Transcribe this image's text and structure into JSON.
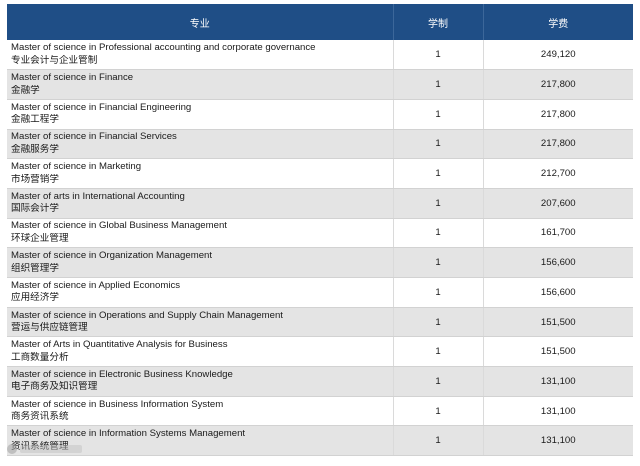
{
  "table": {
    "headers": {
      "major": "专业",
      "duration": "学制",
      "fee": "学费"
    },
    "rows": [
      {
        "en": "Master of science in Professional accounting and corporate governance",
        "zh": "专业会计与企业管制",
        "duration": "1",
        "fee": "249,120"
      },
      {
        "en": "Master of science in  Finance",
        "zh": "金融学",
        "duration": "1",
        "fee": "217,800"
      },
      {
        "en": "Master of science in  Financial Engineering",
        "zh": "金融工程学",
        "duration": "1",
        "fee": "217,800"
      },
      {
        "en": "Master of science in Financial Services",
        "zh": "金融服务学",
        "duration": "1",
        "fee": "217,800"
      },
      {
        "en": "Master of science in  Marketing",
        "zh": "市场营销学",
        "duration": "1",
        "fee": "212,700"
      },
      {
        "en": "Master of arts in International Accounting",
        "zh": "国际会计学",
        "duration": "1",
        "fee": "207,600"
      },
      {
        "en": "Master of science in Global Business Management",
        "zh": "环球企业管理",
        "duration": "1",
        "fee": "161,700"
      },
      {
        "en": "Master of science in  Organization Management",
        "zh": "组织管理学",
        "duration": "1",
        "fee": "156,600"
      },
      {
        "en": "Master of science in Applied Economics",
        "zh": "应用经济学",
        "duration": "1",
        "fee": "156,600"
      },
      {
        "en": "Master of science in Operations and Supply Chain Management",
        "zh": "营运与供应链管理",
        "duration": "1",
        "fee": "151,500"
      },
      {
        "en": "Master of Arts in Quantitative Analysis for Business",
        "zh": "工商数量分析",
        "duration": "1",
        "fee": "151,500"
      },
      {
        "en": "Master of science in Electronic Business Knowledge",
        "zh": "电子商务及知识管理",
        "duration": "1",
        "fee": "131,100"
      },
      {
        "en": "Master of science in Business Information System",
        "zh": "商务资讯系统",
        "duration": "1",
        "fee": "131,100"
      },
      {
        "en": "Master of science in Information Systems Management",
        "zh": "资讯系统管理",
        "duration": "1",
        "fee": "131,100"
      }
    ]
  },
  "colors": {
    "header_bg": "#1f4e86",
    "header_text": "#ffffff",
    "row_alt_bg": "#e4e4e4"
  }
}
